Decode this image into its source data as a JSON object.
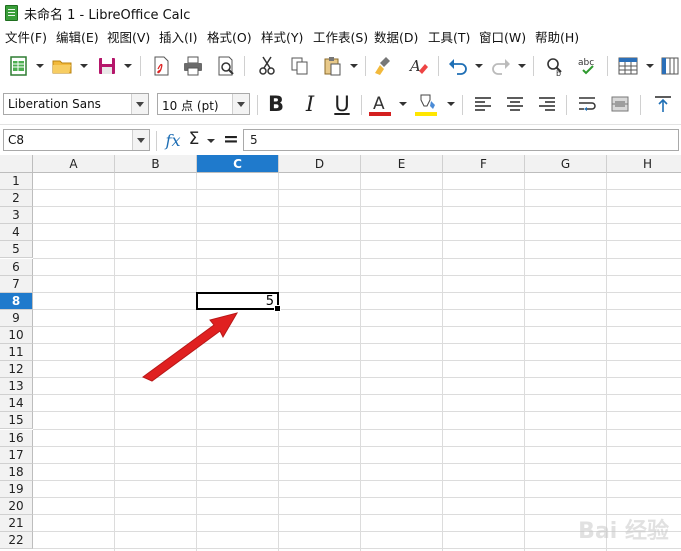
{
  "window": {
    "title": "未命名 1 - LibreOffice Calc"
  },
  "menu": [
    "文件(F)",
    "编辑(E)",
    "视图(V)",
    "插入(I)",
    "格式(O)",
    "样式(Y)",
    "工作表(S)",
    "数据(D)",
    "工具(T)",
    "窗口(W)",
    "帮助(H)"
  ],
  "format_toolbar": {
    "font_name": "Liberation Sans",
    "font_size": "10 点 (pt)",
    "bold": "B",
    "italic": "I",
    "underline": "U",
    "font_color_glyph": "A",
    "font_color": "#d42020",
    "highlight_color": "#ffe600"
  },
  "formula_bar": {
    "name_box": "C8",
    "fx": "fx",
    "sum": "Σ",
    "equals": "=",
    "content": "5"
  },
  "sheet": {
    "columns": [
      "A",
      "B",
      "C",
      "D",
      "E",
      "F",
      "G",
      "H"
    ],
    "rows": [
      "1",
      "2",
      "3",
      "4",
      "5",
      "6",
      "7",
      "8",
      "9",
      "10",
      "11",
      "12",
      "13",
      "14",
      "15",
      "16",
      "17",
      "18",
      "19",
      "20",
      "21",
      "22"
    ],
    "active_column": "C",
    "active_row": "8",
    "cells": [
      {
        "ref": "C8",
        "value": "5"
      }
    ]
  },
  "annotation": {
    "arrow_color": "#e02020",
    "points_to": "C8"
  },
  "watermark": "Bai 经验",
  "colors": {
    "selection_header": "#1f7acc"
  }
}
